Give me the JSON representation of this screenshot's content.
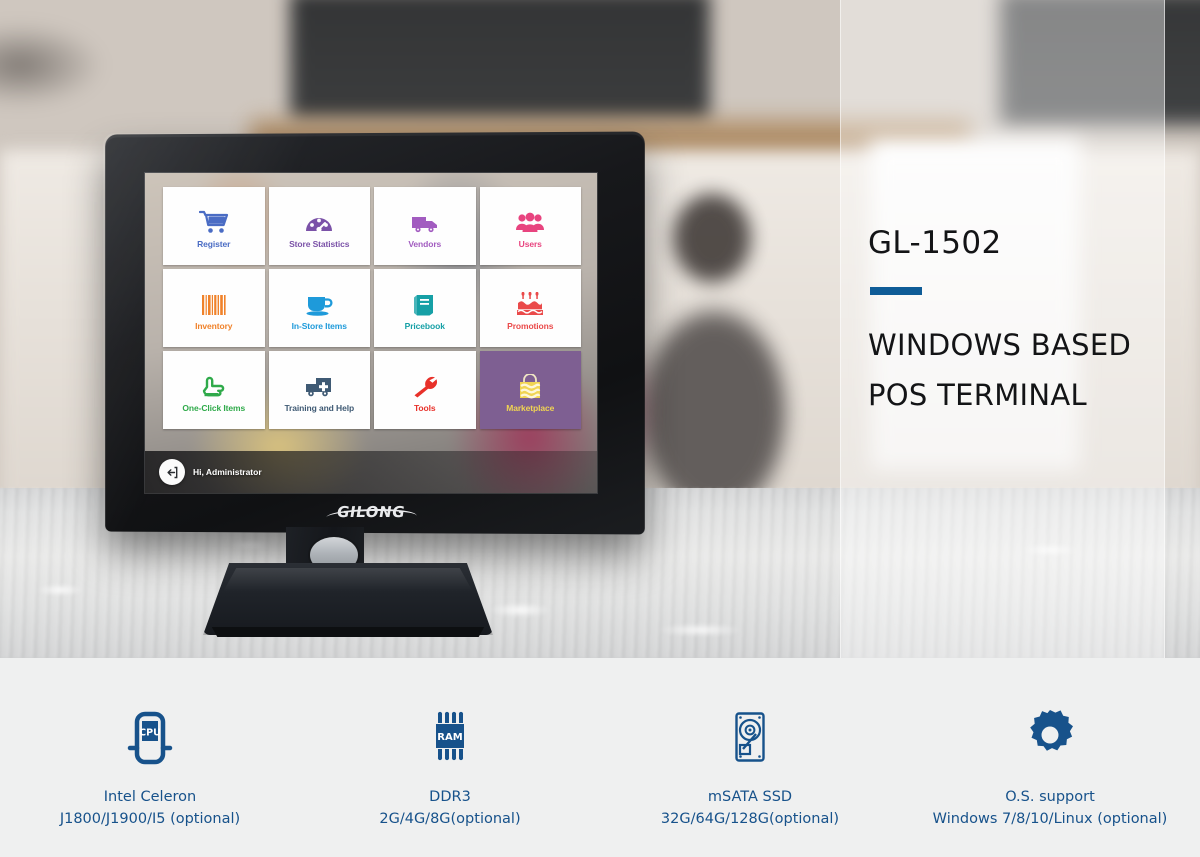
{
  "hero": {
    "model_name": "GL-1502",
    "tagline_line1": "WINDOWS BASED",
    "tagline_line2": "POS TERMINAL",
    "accent_color": "#0f5c97"
  },
  "device": {
    "brand_logo_text": "GILONG"
  },
  "pos_screen": {
    "status_user_greeting": "Hi, Administrator",
    "logout_icon": "logout-arrow-icon",
    "tiles": [
      {
        "label": "Register",
        "icon": "shopping-cart-icon",
        "color": "#4a6cc4",
        "bg": "#fefefe"
      },
      {
        "label": "Store Statistics",
        "icon": "gauge-icon",
        "color": "#7b52a8",
        "bg": "#fefefe"
      },
      {
        "label": "Vendors",
        "icon": "delivery-truck-icon",
        "color": "#a martin",
        "bg": "#fefefe"
      },
      {
        "label": "Users",
        "icon": "users-group-icon",
        "color": "#e8447f",
        "bg": "#fefefe"
      },
      {
        "label": "Inventory",
        "icon": "barcode-icon",
        "color": "#f0822a",
        "bg": "#fefefe"
      },
      {
        "label": "In-Store Items",
        "icon": "coffee-cup-icon",
        "color": "#1e9ada",
        "bg": "#fefefe"
      },
      {
        "label": "Pricebook",
        "icon": "book-icon",
        "color": "#16a0a6",
        "bg": "#fefefe"
      },
      {
        "label": "Promotions",
        "icon": "birthday-cake-icon",
        "color": "#ea4a4a",
        "bg": "#fefefe"
      },
      {
        "label": "One-Click Items",
        "icon": "pointing-hand-icon",
        "color": "#2faa4a",
        "bg": "#fefefe"
      },
      {
        "label": "Training and Help",
        "icon": "ambulance-icon",
        "color": "#3f5a74",
        "bg": "#fefefe"
      },
      {
        "label": "Tools",
        "icon": "wrench-icon",
        "color": "#e8312a",
        "bg": "#fefefe"
      },
      {
        "label": "Marketplace",
        "icon": "shopping-bag-icon",
        "color": "#f0d453",
        "bg": "#7e5f92"
      }
    ]
  },
  "specs": [
    {
      "icon": "cpu-chip-icon",
      "title": "Intel Celeron",
      "detail": "J1800/J1900/I5 (optional)"
    },
    {
      "icon": "ram-chip-icon",
      "title": "DDR3",
      "detail": "2G/4G/8G(optional)"
    },
    {
      "icon": "hard-disk-icon",
      "title": "mSATA SSD",
      "detail": "32G/64G/128G(optional)"
    },
    {
      "icon": "gear-icon",
      "title": "O.S. support",
      "detail": "Windows 7/8/10/Linux (optional)"
    }
  ]
}
